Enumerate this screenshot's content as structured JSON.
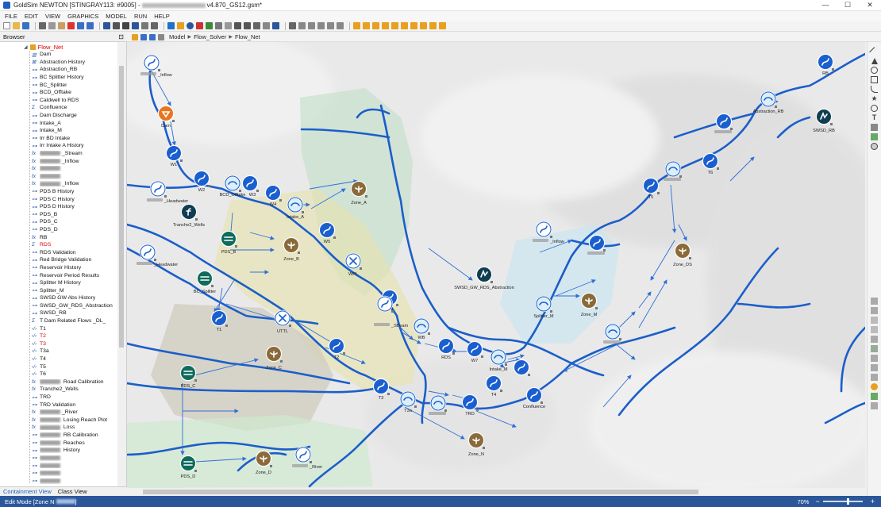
{
  "window": {
    "title_prefix": "GoldSim NEWTON [STINGRAY113: #9005] -",
    "title_suffix": "v4.870_GS12.gsm*",
    "controls": [
      "—",
      "☐",
      "✕"
    ]
  },
  "menu": [
    "FILE",
    "EDIT",
    "VIEW",
    "GRAPHICS",
    "MODEL",
    "RUN",
    "HELP"
  ],
  "breadcrumb": [
    "Model",
    "Flow_Solver",
    "Flow_Net"
  ],
  "browser": {
    "title": "Browser",
    "root": "Flow_Net",
    "items": [
      {
        "icon": "dam",
        "label": "Dam",
        "red": false
      },
      {
        "icon": "history",
        "label": "Abstraction History",
        "red": false
      },
      {
        "icon": "node",
        "label": "Abstraction_RB",
        "red": false
      },
      {
        "icon": "node",
        "label": "BC Splitter History",
        "red": false
      },
      {
        "icon": "node",
        "label": "BC_Splitter",
        "red": false
      },
      {
        "icon": "node",
        "label": "BCD_Offtake",
        "red": false
      },
      {
        "icon": "node",
        "label": "Caldwell to RDS",
        "red": false
      },
      {
        "icon": "sum",
        "label": "Confluence",
        "red": false
      },
      {
        "icon": "node",
        "label": "Dam Discharge",
        "red": false
      },
      {
        "icon": "node",
        "label": "Intake_A",
        "red": false
      },
      {
        "icon": "node",
        "label": "Intake_M",
        "red": false
      },
      {
        "icon": "node",
        "label": "Irr BD Intake",
        "red": false
      },
      {
        "icon": "node",
        "label": "Irr Intake A History",
        "red": false
      },
      {
        "icon": "fx",
        "label": "_Stream",
        "red": false,
        "blur": true
      },
      {
        "icon": "fx",
        "label": "_Inflow",
        "red": false,
        "blur": true
      },
      {
        "icon": "fx",
        "label": "",
        "red": false,
        "blur": true
      },
      {
        "icon": "fx",
        "label": "",
        "red": false,
        "blur": true
      },
      {
        "icon": "fx",
        "label": "_Inflow",
        "red": false,
        "blur": true
      },
      {
        "icon": "node",
        "label": "PDS B History",
        "red": false
      },
      {
        "icon": "node",
        "label": "PDS C History",
        "red": false
      },
      {
        "icon": "node",
        "label": "PDS D History",
        "red": false
      },
      {
        "icon": "node",
        "label": "PDS_B",
        "red": false
      },
      {
        "icon": "node",
        "label": "PDS_C",
        "red": false
      },
      {
        "icon": "node",
        "label": "PDS_D",
        "red": false
      },
      {
        "icon": "fx",
        "label": "RB",
        "red": false
      },
      {
        "icon": "sum",
        "label": "RDS",
        "red": true
      },
      {
        "icon": "node",
        "label": "RDS Validation",
        "red": false
      },
      {
        "icon": "node",
        "label": "Red Bridge Validation",
        "red": false
      },
      {
        "icon": "node",
        "label": "Reservoir History",
        "red": false
      },
      {
        "icon": "node",
        "label": "Reservoir Period Results",
        "red": false
      },
      {
        "icon": "node",
        "label": "Splitter M History",
        "red": false
      },
      {
        "icon": "node",
        "label": "Splitter_M",
        "red": false
      },
      {
        "icon": "node",
        "label": "SWSD GW Abs History",
        "red": false
      },
      {
        "icon": "node",
        "label": "SWSD_GW_RDS_Abstraction",
        "red": false
      },
      {
        "icon": "node",
        "label": "SWSD_RB",
        "red": false
      },
      {
        "icon": "sum",
        "label": "T Dam Related Flows _DL_",
        "red": false
      },
      {
        "icon": "link",
        "label": "T1",
        "red": false
      },
      {
        "icon": "link",
        "label": "T2",
        "red": true
      },
      {
        "icon": "link",
        "label": "T3",
        "red": true
      },
      {
        "icon": "link",
        "label": "T3a",
        "red": false
      },
      {
        "icon": "link",
        "label": "T4",
        "red": false
      },
      {
        "icon": "link",
        "label": "T5",
        "red": false
      },
      {
        "icon": "link",
        "label": "T6",
        "red": false
      },
      {
        "icon": "fx",
        "label": " Road Calibration",
        "red": false,
        "blur": true
      },
      {
        "icon": "fx",
        "label": "Tranche2_Wells",
        "red": false
      },
      {
        "icon": "node",
        "label": "TRD",
        "red": false
      },
      {
        "icon": "node",
        "label": "TRD Validation",
        "red": false
      },
      {
        "icon": "fx",
        "label": "_River",
        "red": false,
        "blur": true
      },
      {
        "icon": "fx",
        "label": " Losing Reach Plot",
        "red": false,
        "blur": true
      },
      {
        "icon": "fx",
        "label": " Loss",
        "red": false,
        "blur": true
      },
      {
        "icon": "node",
        "label": " RB Calibration",
        "red": false,
        "blur": true
      },
      {
        "icon": "node",
        "label": " Reaches",
        "red": false,
        "blur": true
      },
      {
        "icon": "node",
        "label": " History",
        "red": false,
        "blur": true
      },
      {
        "icon": "node",
        "label": "",
        "red": false,
        "blur": true
      },
      {
        "icon": "node",
        "label": "",
        "red": false,
        "blur": true
      },
      {
        "icon": "node",
        "label": "",
        "red": false,
        "blur": true
      },
      {
        "icon": "node",
        "label": "",
        "red": false,
        "blur": true
      }
    ]
  },
  "bottom_tabs": {
    "containment": "Containment View",
    "class": "Class View"
  },
  "status": {
    "mode": "Edit Mode [Zone N",
    "zoom": "70%"
  },
  "canvas": {
    "labels": [
      {
        "key": "l_inflow",
        "text": "_Inflow"
      },
      {
        "key": "l_dam",
        "text": "Dam"
      },
      {
        "key": "l_w1",
        "text": "W1"
      },
      {
        "key": "l_headwater1",
        "text": "_Headwater"
      },
      {
        "key": "l_w2",
        "text": "W2"
      },
      {
        "key": "l_bcd",
        "text": "BCD_Offtake"
      },
      {
        "key": "l_w3",
        "text": "W3"
      },
      {
        "key": "l_w4",
        "text": "W4"
      },
      {
        "key": "l_intakea",
        "text": "Intake_A"
      },
      {
        "key": "l_zonea",
        "text": "Zone_A"
      },
      {
        "key": "l_tranche",
        "text": "Tranche2_Wells"
      },
      {
        "key": "l_pdsb",
        "text": "PDS_B"
      },
      {
        "key": "l_zoneb",
        "text": "Zone_B"
      },
      {
        "key": "l_w5",
        "text": "W5"
      },
      {
        "key": "l_wpl",
        "text": "WPL"
      },
      {
        "key": "l_headwater2",
        "text": "_Headwater"
      },
      {
        "key": "l_bcsplit",
        "text": "BC_Splitter"
      },
      {
        "key": "l_w6",
        "text": "W6"
      },
      {
        "key": "l_t1",
        "text": "T1"
      },
      {
        "key": "l_uttl",
        "text": "UTTL"
      },
      {
        "key": "l_stream",
        "text": "_Stream"
      },
      {
        "key": "l_wb",
        "text": "WB"
      },
      {
        "key": "l_rds",
        "text": "RDS"
      },
      {
        "key": "l_w7",
        "text": "W7"
      },
      {
        "key": "l_intakem",
        "text": "Intake_M"
      },
      {
        "key": "l_t2",
        "text": "T2"
      },
      {
        "key": "l_zonec",
        "text": "Zone_C"
      },
      {
        "key": "l_pdsc",
        "text": "PDS_C"
      },
      {
        "key": "l_t3",
        "text": "T3"
      },
      {
        "key": "l_t3a",
        "text": "T3a"
      },
      {
        "key": "l_trd",
        "text": "TRD"
      },
      {
        "key": "l_t4",
        "text": "T4"
      },
      {
        "key": "l_conf",
        "text": "Confluence"
      },
      {
        "key": "l_zonen",
        "text": "Zone_N"
      },
      {
        "key": "l_pdsd",
        "text": "PDS_D"
      },
      {
        "key": "l_zoned",
        "text": "Zone_D"
      },
      {
        "key": "l_river",
        "text": "_River"
      },
      {
        "key": "l_swsdgw",
        "text": "SWSD_GW_RDS_Abstraction"
      },
      {
        "key": "l_splitm",
        "text": "Splitter_M"
      },
      {
        "key": "l_zonem",
        "text": "Zone_M"
      },
      {
        "key": "l_inflow2",
        "text": "_Inflow"
      },
      {
        "key": "l_t5",
        "text": "T5"
      },
      {
        "key": "l_t6",
        "text": "T6"
      },
      {
        "key": "l_zoneds",
        "text": "Zone_DS"
      },
      {
        "key": "l_absrb",
        "text": "Abstraction_RB"
      },
      {
        "key": "l_swsdrb",
        "text": "SWSD_RB"
      },
      {
        "key": "l_rb",
        "text": "RB"
      }
    ]
  },
  "colors": {
    "accent": "#2b579a",
    "river": "#1b5ec9",
    "node_blue": "#1a5fcf",
    "zone_brown": "#8b6a3a",
    "pds_green": "#0f6b5c",
    "dam_orange": "#e8761f"
  }
}
